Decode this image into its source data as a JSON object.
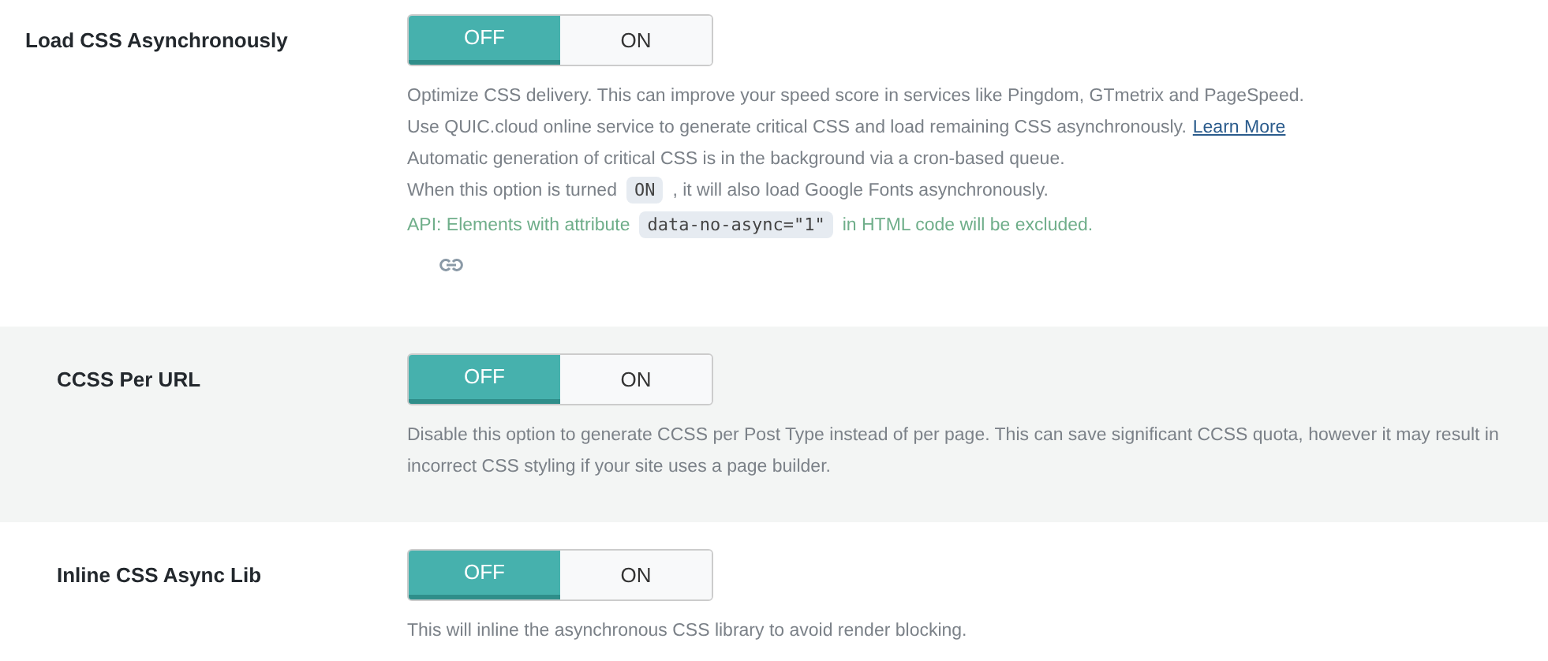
{
  "settings": [
    {
      "label": "Load CSS Asynchronously",
      "shaded": false,
      "indented": false,
      "options": [
        {
          "label": "OFF",
          "selected": true
        },
        {
          "label": "ON",
          "selected": false
        }
      ],
      "lines": [
        {
          "kind": "note",
          "parts": [
            {
              "kind": "text",
              "text": "Optimize CSS delivery. This can improve your speed score in services like Pingdom, GTmetrix and PageSpeed."
            }
          ]
        },
        {
          "kind": "note",
          "parts": [
            {
              "kind": "text",
              "text": "Use QUIC.cloud online service to generate critical CSS and load remaining CSS asynchronously."
            },
            {
              "kind": "link",
              "text": "Learn More"
            }
          ]
        },
        {
          "kind": "note",
          "parts": [
            {
              "kind": "text",
              "text": "Automatic generation of critical CSS is in the background via a cron-based queue."
            }
          ]
        },
        {
          "kind": "note",
          "parts": [
            {
              "kind": "text",
              "text": "When this option is turned"
            },
            {
              "kind": "code",
              "text": "ON"
            },
            {
              "kind": "text",
              "text": ", it will also load Google Fonts asynchronously."
            }
          ]
        },
        {
          "kind": "api",
          "parts": [
            {
              "kind": "text",
              "text": "API: Elements with attribute"
            },
            {
              "kind": "code",
              "text": "data-no-async=\"1\""
            },
            {
              "kind": "text",
              "text": "in HTML code will be excluded."
            }
          ]
        }
      ],
      "permalink": true
    },
    {
      "label": "CCSS Per URL",
      "shaded": true,
      "indented": true,
      "options": [
        {
          "label": "OFF",
          "selected": true
        },
        {
          "label": "ON",
          "selected": false
        }
      ],
      "lines": [
        {
          "kind": "note",
          "parts": [
            {
              "kind": "text",
              "text": "Disable this option to generate CCSS per Post Type instead of per page. This can save significant CCSS quota, however it may result in incorrect CSS styling if your site uses a page builder."
            }
          ]
        }
      ],
      "permalink": false
    },
    {
      "label": "Inline CSS Async Lib",
      "shaded": false,
      "indented": true,
      "options": [
        {
          "label": "OFF",
          "selected": true
        },
        {
          "label": "ON",
          "selected": false
        }
      ],
      "lines": [
        {
          "kind": "note",
          "parts": [
            {
              "kind": "text",
              "text": "This will inline the asynchronous CSS library to avoid render blocking."
            }
          ]
        }
      ],
      "permalink": false
    }
  ]
}
